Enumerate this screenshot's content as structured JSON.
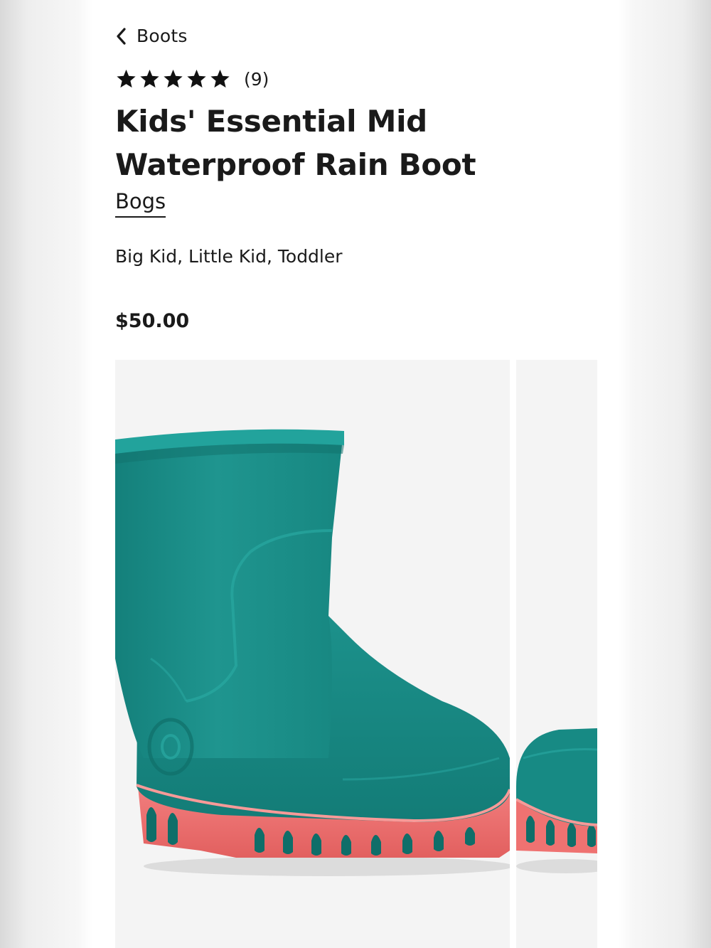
{
  "nav": {
    "back_label": "Boots",
    "back_icon": "chevron-left-icon"
  },
  "rating": {
    "stars": 5,
    "max_stars": 5,
    "count_text": "(9)"
  },
  "product": {
    "title": "Kids' Essential Mid Waterproof Rain Boot",
    "brand": "Bogs",
    "sizes": "Big Kid, Little Kid, Toddler",
    "price": "$50.00"
  },
  "gallery": {
    "images": [
      {
        "subject": "teal rain boot with coral pink sole"
      },
      {
        "subject": "teal rain boot with coral pink sole (partially visible)"
      }
    ]
  },
  "colors": {
    "boot_teal": "#1f948e",
    "sole_coral": "#ef6f70",
    "image_bg": "#f4f4f4",
    "text": "#1a1a1a"
  }
}
